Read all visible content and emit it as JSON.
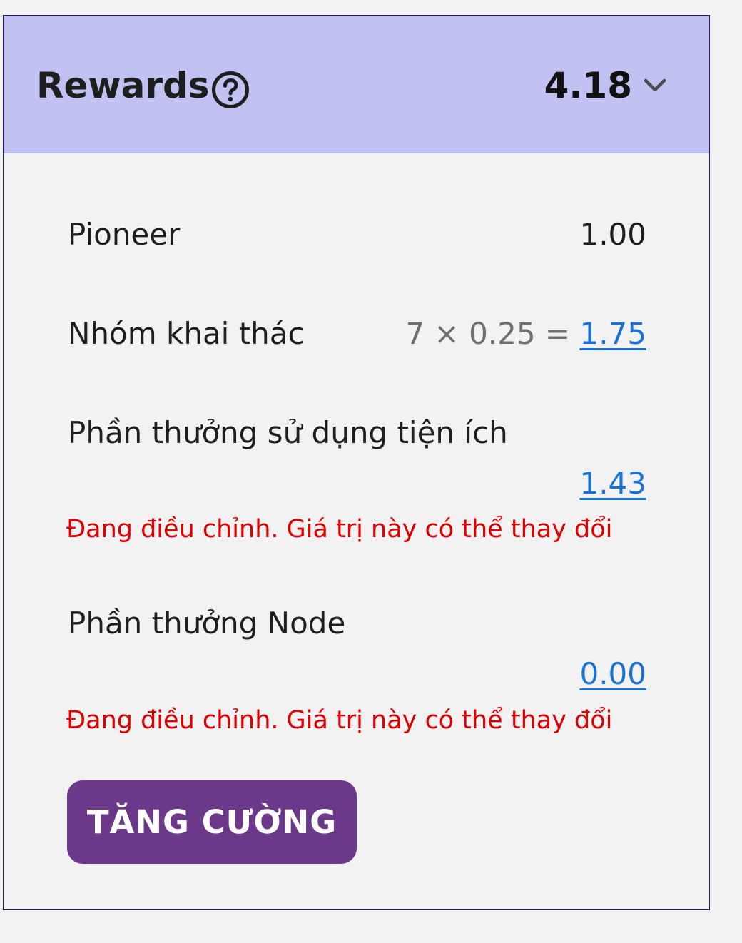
{
  "header": {
    "title": "Rewards",
    "total": "4.18"
  },
  "rows": {
    "pioneer": {
      "label": "Pioneer",
      "value": "1.00"
    },
    "security_circle": {
      "label": "Nhóm khai thác",
      "formula": "7 × 0.25 = ",
      "value": "1.75"
    },
    "utility": {
      "label": "Phần thưởng sử dụng tiện ích",
      "value": "1.43",
      "warning": "Đang điều chỉnh. Giá trị này có thể thay đổi"
    },
    "node": {
      "label": "Phần thưởng Node",
      "value": "0.00",
      "warning": "Đang điều chỉnh. Giá trị này có thể thay đổi"
    }
  },
  "boost_button": {
    "label": "TĂNG CƯỜNG"
  },
  "colors": {
    "header_bg": "#c2c2f2",
    "link": "#1a72d6",
    "warning": "#e00000",
    "button_bg": "#6b388a",
    "border": "#1c1c8a"
  },
  "icons": {
    "help": "question-circle-icon",
    "expand": "chevron-down-icon"
  }
}
